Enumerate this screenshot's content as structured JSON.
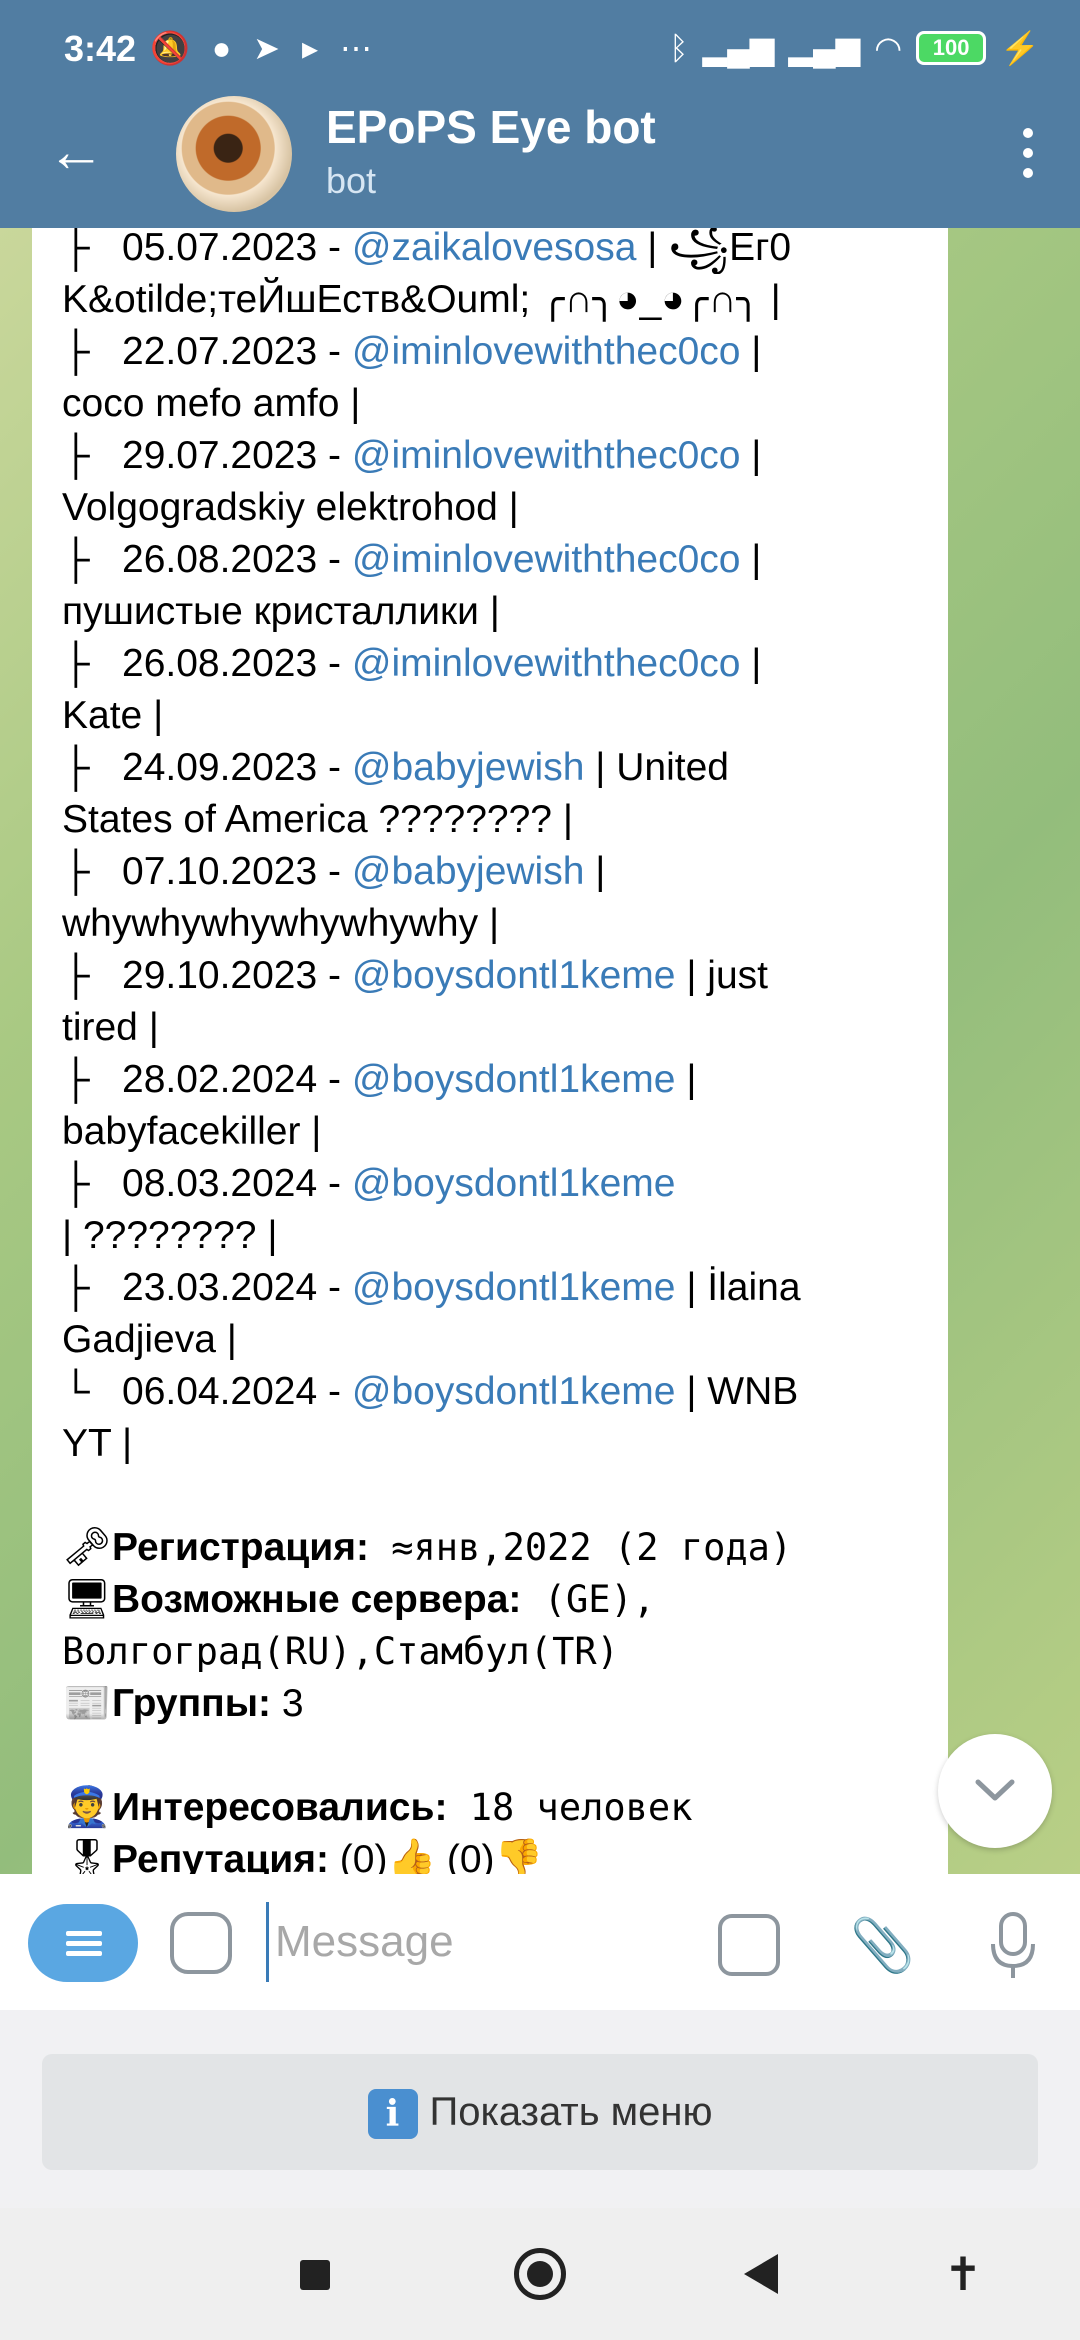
{
  "status_bar": {
    "time": "3:42",
    "battery": "100"
  },
  "header": {
    "title": "EPoPS Eye bot",
    "subtitle": "bot"
  },
  "message": {
    "history": [
      {
        "prefix": "├",
        "date": "05.07.2023",
        "user": "@zaikalovesosa",
        "text": " | ꧁Ег0"
      },
      {
        "prefix": "",
        "date": "",
        "user": "",
        "text": "K&otilde;теЙшЕств&Ouml; ╭∩╮◕_◕╭∩╮ |"
      },
      {
        "prefix": "├",
        "date": "22.07.2023",
        "user": "@iminlovewiththec0co",
        "text": " |"
      },
      {
        "prefix": "",
        "date": "",
        "user": "",
        "text": "coco mefo amfo |"
      },
      {
        "prefix": "├",
        "date": "29.07.2023",
        "user": "@iminlovewiththec0co",
        "text": " |"
      },
      {
        "prefix": "",
        "date": "",
        "user": "",
        "text": "Volgogradskiy elektrohod |"
      },
      {
        "prefix": "├",
        "date": "26.08.2023",
        "user": "@iminlovewiththec0co",
        "text": " |"
      },
      {
        "prefix": "",
        "date": "",
        "user": "",
        "text": "пушистые кристаллики |"
      },
      {
        "prefix": "├",
        "date": "26.08.2023",
        "user": "@iminlovewiththec0co",
        "text": " |"
      },
      {
        "prefix": "",
        "date": "",
        "user": "",
        "text": "Kate |"
      },
      {
        "prefix": "├",
        "date": "24.09.2023",
        "user": "@babyjewish",
        "text": " | United"
      },
      {
        "prefix": "",
        "date": "",
        "user": "",
        "text": "States of America ???????? |"
      },
      {
        "prefix": "├",
        "date": "07.10.2023",
        "user": "@babyjewish",
        "text": " |"
      },
      {
        "prefix": "",
        "date": "",
        "user": "",
        "text": "whywhywhywhywhywhy |"
      },
      {
        "prefix": "├",
        "date": "29.10.2023",
        "user": "@boysdontl1keme",
        "text": " | just"
      },
      {
        "prefix": "",
        "date": "",
        "user": "",
        "text": "tired |"
      },
      {
        "prefix": "├",
        "date": "28.02.2024",
        "user": "@boysdontl1keme",
        "text": " |"
      },
      {
        "prefix": "",
        "date": "",
        "user": "",
        "text": "babyfacekiller |"
      },
      {
        "prefix": "├",
        "date": "08.03.2024",
        "user": "@boysdontl1keme",
        "text": ""
      },
      {
        "prefix": "",
        "date": "",
        "user": "",
        "text": "| ???????? |"
      },
      {
        "prefix": "├",
        "date": "23.03.2024",
        "user": "@boysdontl1keme",
        "text": " | İlaina"
      },
      {
        "prefix": "",
        "date": "",
        "user": "",
        "text": "Gadjieva |"
      },
      {
        "prefix": "└",
        "date": "06.04.2024",
        "user": "@boysdontl1keme",
        "text": " | WNB"
      },
      {
        "prefix": "",
        "date": "",
        "user": "",
        "text": "YT |"
      }
    ],
    "registration_label": "Регистрация:",
    "registration_value": " ≈янв,2022 (2 года)",
    "servers_label": "Возможные сервера:",
    "servers_value_1": " (GE),",
    "servers_value_2": "Волгоград(RU),Стамбул(TR)",
    "groups_label": "Группы:",
    "groups_value": " 3",
    "interested_label": "Интересовались:",
    "interested_value": " 18 человек",
    "reputation_label": "Репутация:",
    "reputation_value": " (0)👍 (0)👎"
  },
  "input": {
    "placeholder": "Message"
  },
  "show_menu_label": "Показать меню"
}
